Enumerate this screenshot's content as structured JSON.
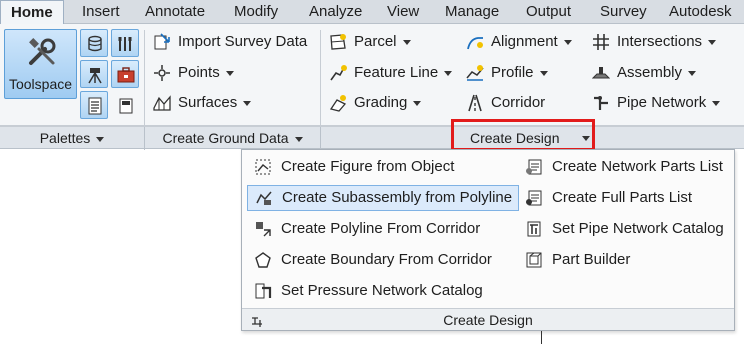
{
  "tabs": [
    {
      "label": "Home",
      "active": true
    },
    {
      "label": "Insert"
    },
    {
      "label": "Annotate"
    },
    {
      "label": "Modify"
    },
    {
      "label": "Analyze"
    },
    {
      "label": "View"
    },
    {
      "label": "Manage"
    },
    {
      "label": "Output"
    },
    {
      "label": "Survey"
    },
    {
      "label": "Autodesk"
    }
  ],
  "palettes": {
    "toolspace_label": "Toolspace",
    "footer": "Palettes"
  },
  "ground": {
    "items": [
      "Import Survey Data",
      "Points",
      "Surfaces"
    ],
    "footer": "Create Ground Data"
  },
  "design": {
    "col1": [
      "Parcel",
      "Feature Line",
      "Grading"
    ],
    "col2": [
      "Alignment",
      "Profile",
      "Corridor"
    ],
    "col3": [
      "Intersections",
      "Assembly",
      "Pipe Network"
    ],
    "footer": "Create Design"
  },
  "dropdown": {
    "left": [
      "Create Figure from Object",
      "Create Subassembly from Polyline",
      "Create Polyline From Corridor",
      "Create Boundary From Corridor",
      "Set Pressure Network Catalog"
    ],
    "right": [
      "Create Network Parts List",
      "Create Full Parts List",
      "Set Pipe Network Catalog",
      "Part Builder"
    ],
    "footer": "Create Design"
  },
  "colors": {
    "highlight_box": "#e21b1b",
    "hover_item": "#dbeafb",
    "ribbon_bg": "#f4f6f8"
  }
}
